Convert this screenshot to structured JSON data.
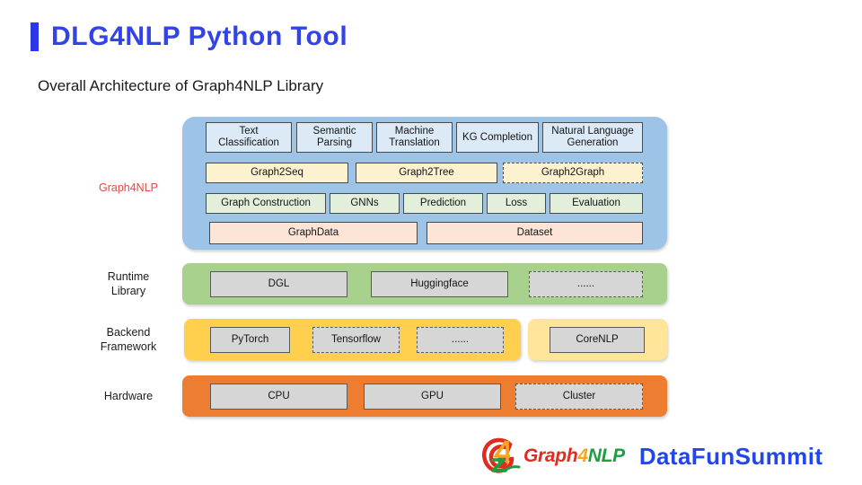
{
  "header": {
    "title": "DLG4NLP Python Tool",
    "accent_color": "#3344e6",
    "subtitle": "Overall Architecture of Graph4NLP Library"
  },
  "diagram": {
    "labels": {
      "graph4nlp": "Graph4NLP",
      "runtime": "Runtime\nLibrary",
      "runtime_line1": "Runtime",
      "runtime_line2": "Library",
      "backend_line1": "Backend",
      "backend_line2": "Framework",
      "hardware": "Hardware"
    },
    "bands": {
      "graph4nlp_color": "#9dc3e6",
      "runtime_color": "#a9d18e",
      "backend_left_color": "#ffcf4d",
      "backend_right_color": "#ffe599",
      "hardware_color": "#ed7d31"
    },
    "applications": [
      {
        "line1": "Text",
        "line2": "Classification",
        "dashed": false
      },
      {
        "line1": "Semantic",
        "line2": "Parsing",
        "dashed": false
      },
      {
        "line1": "Machine",
        "line2": "Translation",
        "dashed": false
      },
      {
        "line1": "KG Completion",
        "line2": "",
        "dashed": false
      },
      {
        "line1": "Natural Language",
        "line2": "Generation",
        "dashed": false
      }
    ],
    "models": [
      {
        "label": "Graph2Seq",
        "dashed": false
      },
      {
        "label": "Graph2Tree",
        "dashed": false
      },
      {
        "label": "Graph2Graph",
        "dashed": true
      }
    ],
    "modules": [
      {
        "label": "Graph Construction",
        "dashed": false
      },
      {
        "label": "GNNs",
        "dashed": false
      },
      {
        "label": "Prediction",
        "dashed": false
      },
      {
        "label": "Loss",
        "dashed": false
      },
      {
        "label": "Evaluation",
        "dashed": false
      }
    ],
    "data_layer": [
      {
        "label": "GraphData",
        "dashed": false
      },
      {
        "label": "Dataset",
        "dashed": false
      }
    ],
    "runtime_library": [
      {
        "label": "DGL",
        "dashed": false
      },
      {
        "label": "Huggingface",
        "dashed": false
      },
      {
        "label": "......",
        "dashed": true
      }
    ],
    "backend_framework_left": [
      {
        "label": "PyTorch",
        "dashed": false
      },
      {
        "label": "Tensorflow",
        "dashed": true
      },
      {
        "label": "......",
        "dashed": true
      }
    ],
    "backend_framework_right": [
      {
        "label": "CoreNLP",
        "dashed": false
      }
    ],
    "hardware": [
      {
        "label": "CPU",
        "dashed": false
      },
      {
        "label": "GPU",
        "dashed": false
      },
      {
        "label": "Cluster",
        "dashed": true
      }
    ]
  },
  "footer": {
    "graph4nlp_logo": {
      "part1": "Graph",
      "part2": "4",
      "part3": "NLP",
      "icon": "graph4nlp-circular-logo-icon"
    },
    "datafun_logo": "DataFunSummit"
  }
}
